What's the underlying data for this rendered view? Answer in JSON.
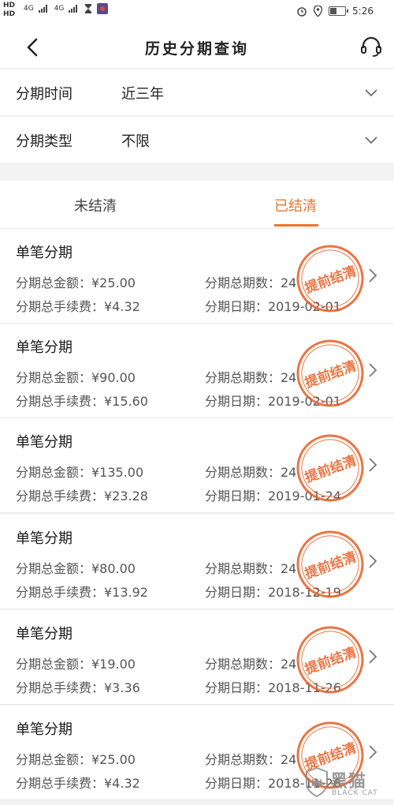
{
  "status_bar": {
    "network_left": "4G",
    "network_right": "4G",
    "time": "5:26",
    "battery_level": 0.4
  },
  "nav": {
    "title": "历史分期查询",
    "back_icon": "chevron-left-icon",
    "support_icon": "headset-icon"
  },
  "filters": {
    "period": {
      "label": "分期时间",
      "value": "近三年"
    },
    "type": {
      "label": "分期类型",
      "value": "不限"
    }
  },
  "tabs": [
    {
      "label": "未结清",
      "active": false
    },
    {
      "label": "已结清",
      "active": true
    }
  ],
  "stamp_text": "提前结清",
  "records": [
    {
      "title": "单笔分期",
      "amount": "分期总金额：¥25.00",
      "periods": "分期总期数：24",
      "fee": "分期总手续费：¥4.32",
      "date": "分期日期：2019-02-01"
    },
    {
      "title": "单笔分期",
      "amount": "分期总金额：¥90.00",
      "periods": "分期总期数：24",
      "fee": "分期总手续费：¥15.60",
      "date": "分期日期：2019-02-01"
    },
    {
      "title": "单笔分期",
      "amount": "分期总金额：¥135.00",
      "periods": "分期总期数：24",
      "fee": "分期总手续费：¥23.28",
      "date": "分期日期：2019-01-24"
    },
    {
      "title": "单笔分期",
      "amount": "分期总金额：¥80.00",
      "periods": "分期总期数：24",
      "fee": "分期总手续费：¥13.92",
      "date": "分期日期：2018-12-19"
    },
    {
      "title": "单笔分期",
      "amount": "分期总金额：¥19.00",
      "periods": "分期总期数：24",
      "fee": "分期总手续费：¥3.36",
      "date": "分期日期：2018-11-26"
    },
    {
      "title": "单笔分期",
      "amount": "分期总金额：¥25.00",
      "periods": "分期总期数：24",
      "fee": "分期总手续费：¥4.32",
      "date": "分期日期：2018-11-26"
    }
  ],
  "watermark": {
    "main": "黑猫",
    "sub": "BLACK CAT"
  },
  "colors": {
    "accent": "#e8772e",
    "stamp": "#e8622a",
    "page_background": "#f3f3f3"
  }
}
